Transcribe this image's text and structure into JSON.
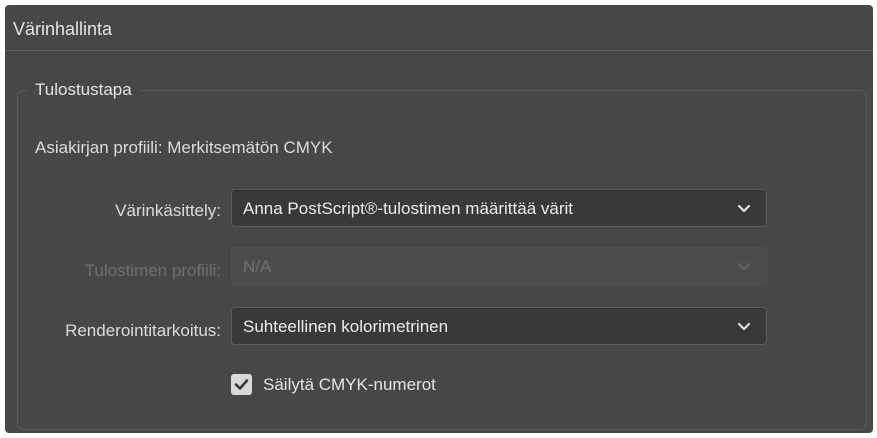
{
  "panel": {
    "title": "Värinhallinta"
  },
  "output_group": {
    "title": "Tulostustapa",
    "document_profile": "Asiakirjan profiili: Merkitsemätön CMYK",
    "color_handling": {
      "label": "Värinkäsittely:",
      "value": "Anna PostScript®-tulostimen määrittää värit"
    },
    "printer_profile": {
      "label": "Tulostimen profiili:",
      "value": "N/A",
      "disabled": true
    },
    "rendering_intent": {
      "label": "Renderointitarkoitus:",
      "value": "Suhteellinen kolorimetrinen"
    },
    "preserve_cmyk": {
      "label": "Säilytä CMYK-numerot",
      "checked": true
    }
  },
  "icons": {
    "dropdown": "chevron-down-icon",
    "check": "checkmark-icon"
  },
  "colors": {
    "panel_bg": "#474747",
    "field_bg": "#393939",
    "text": "#e4e4e4",
    "disabled_text": "#6f6f6f"
  }
}
